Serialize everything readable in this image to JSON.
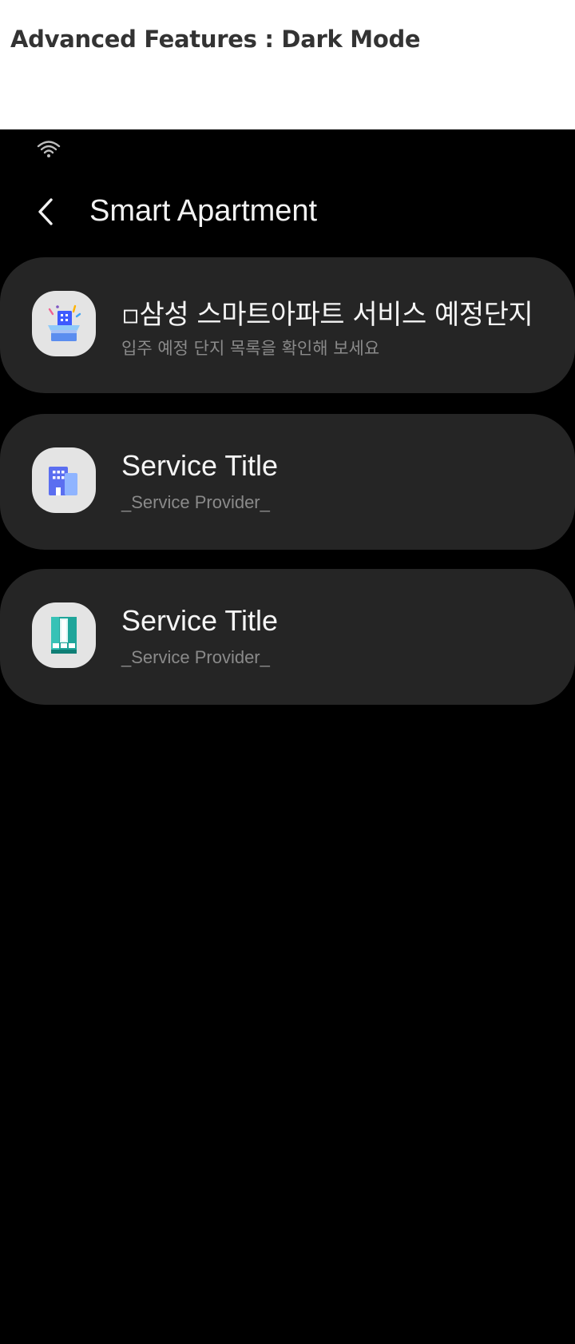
{
  "caption": {
    "text": "Advanced Features : Dark Mode"
  },
  "status_bar": {
    "icons": [
      "wifi-icon"
    ]
  },
  "app_bar": {
    "back_icon": "chevron-left-icon",
    "title": "Smart Apartment"
  },
  "colors": {
    "background": "#000000",
    "card": "#252525",
    "title_text": "#f5f5f5",
    "subtitle_text": "#8a8a8a",
    "icon_tile": "#e4e4e4",
    "accent_blue": "#5b8def",
    "accent_teal": "#1fa59a"
  },
  "services": [
    {
      "icon": "gift-box-building-icon",
      "title": "▫삼성 스마트아파트 서비스 예정단지",
      "subtitle": "입주 예정 단지 목록을 확인해 보세요"
    },
    {
      "icon": "building-icon",
      "title": "Service Title",
      "subtitle": "_Service Provider_"
    },
    {
      "icon": "teal-tower-logo-icon",
      "title": "Service Title",
      "subtitle": "_Service Provider_"
    }
  ]
}
